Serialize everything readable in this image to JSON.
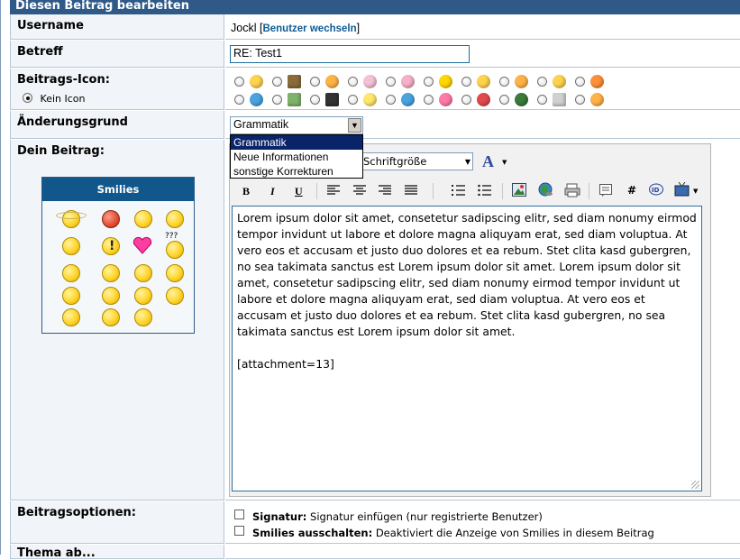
{
  "header": {
    "title": "Diesen Beitrag bearbeiten"
  },
  "rows": {
    "username": {
      "label": "Username",
      "value": "Jockl",
      "bracket_open": "[",
      "switch_link": "Benutzer wechseln",
      "bracket_close": "]"
    },
    "subject": {
      "label": "Betreff",
      "value": "RE: Test1"
    },
    "post_icon": {
      "label": "Beitrags-Icon:",
      "no_icon": "Kein Icon"
    },
    "reason": {
      "label": "Änderungsgrund",
      "selected": "Grammatik",
      "options": [
        "Grammatik",
        "Neue Informationen",
        "sonstige Korrekturen"
      ]
    },
    "post": {
      "label": "Dein Beitrag:"
    },
    "options": {
      "label": "Beitragsoptionen:",
      "signature_bold": "Signatur:",
      "signature_text": "Signatur einfügen (nur registrierte Benutzer)",
      "smilies_bold": "Smilies ausschalten:",
      "smilies_text": "Deaktiviert die Anzeige von Smilies in diesem Beitrag"
    },
    "last_row_label": "Thema ab..."
  },
  "editor": {
    "font_size_select": "Schriftgröße",
    "toolbar": {
      "bold": "B",
      "italic": "I",
      "underline": "U",
      "hash": "#"
    },
    "text": "Lorem ipsum dolor sit amet, consetetur sadipscing elitr, sed diam nonumy eirmod tempor invidunt ut labore et dolore magna aliquyam erat, sed diam voluptua. At vero eos et accusam et justo duo dolores et ea rebum. Stet clita kasd gubergren, no sea takimata sanctus est Lorem ipsum dolor sit amet. Lorem ipsum dolor sit amet, consetetur sadipscing elitr, sed diam nonumy eirmod tempor invidunt ut labore et dolore magna aliquyam erat, sed diam voluptua. At vero eos et accusam et justo duo dolores et ea rebum. Stet clita kasd gubergren, no sea takimata sanctus est Lorem ipsum dolor sit amet.",
    "attachment": "[attachment=13]"
  },
  "smilies": {
    "title": "Smilies",
    "question_marks": "???"
  },
  "colors": {
    "header_bg": "#2f5a88",
    "link": "#0f5b95",
    "dropdown_selected": "#0a246a",
    "smilies_title_bg": "#11578b"
  }
}
